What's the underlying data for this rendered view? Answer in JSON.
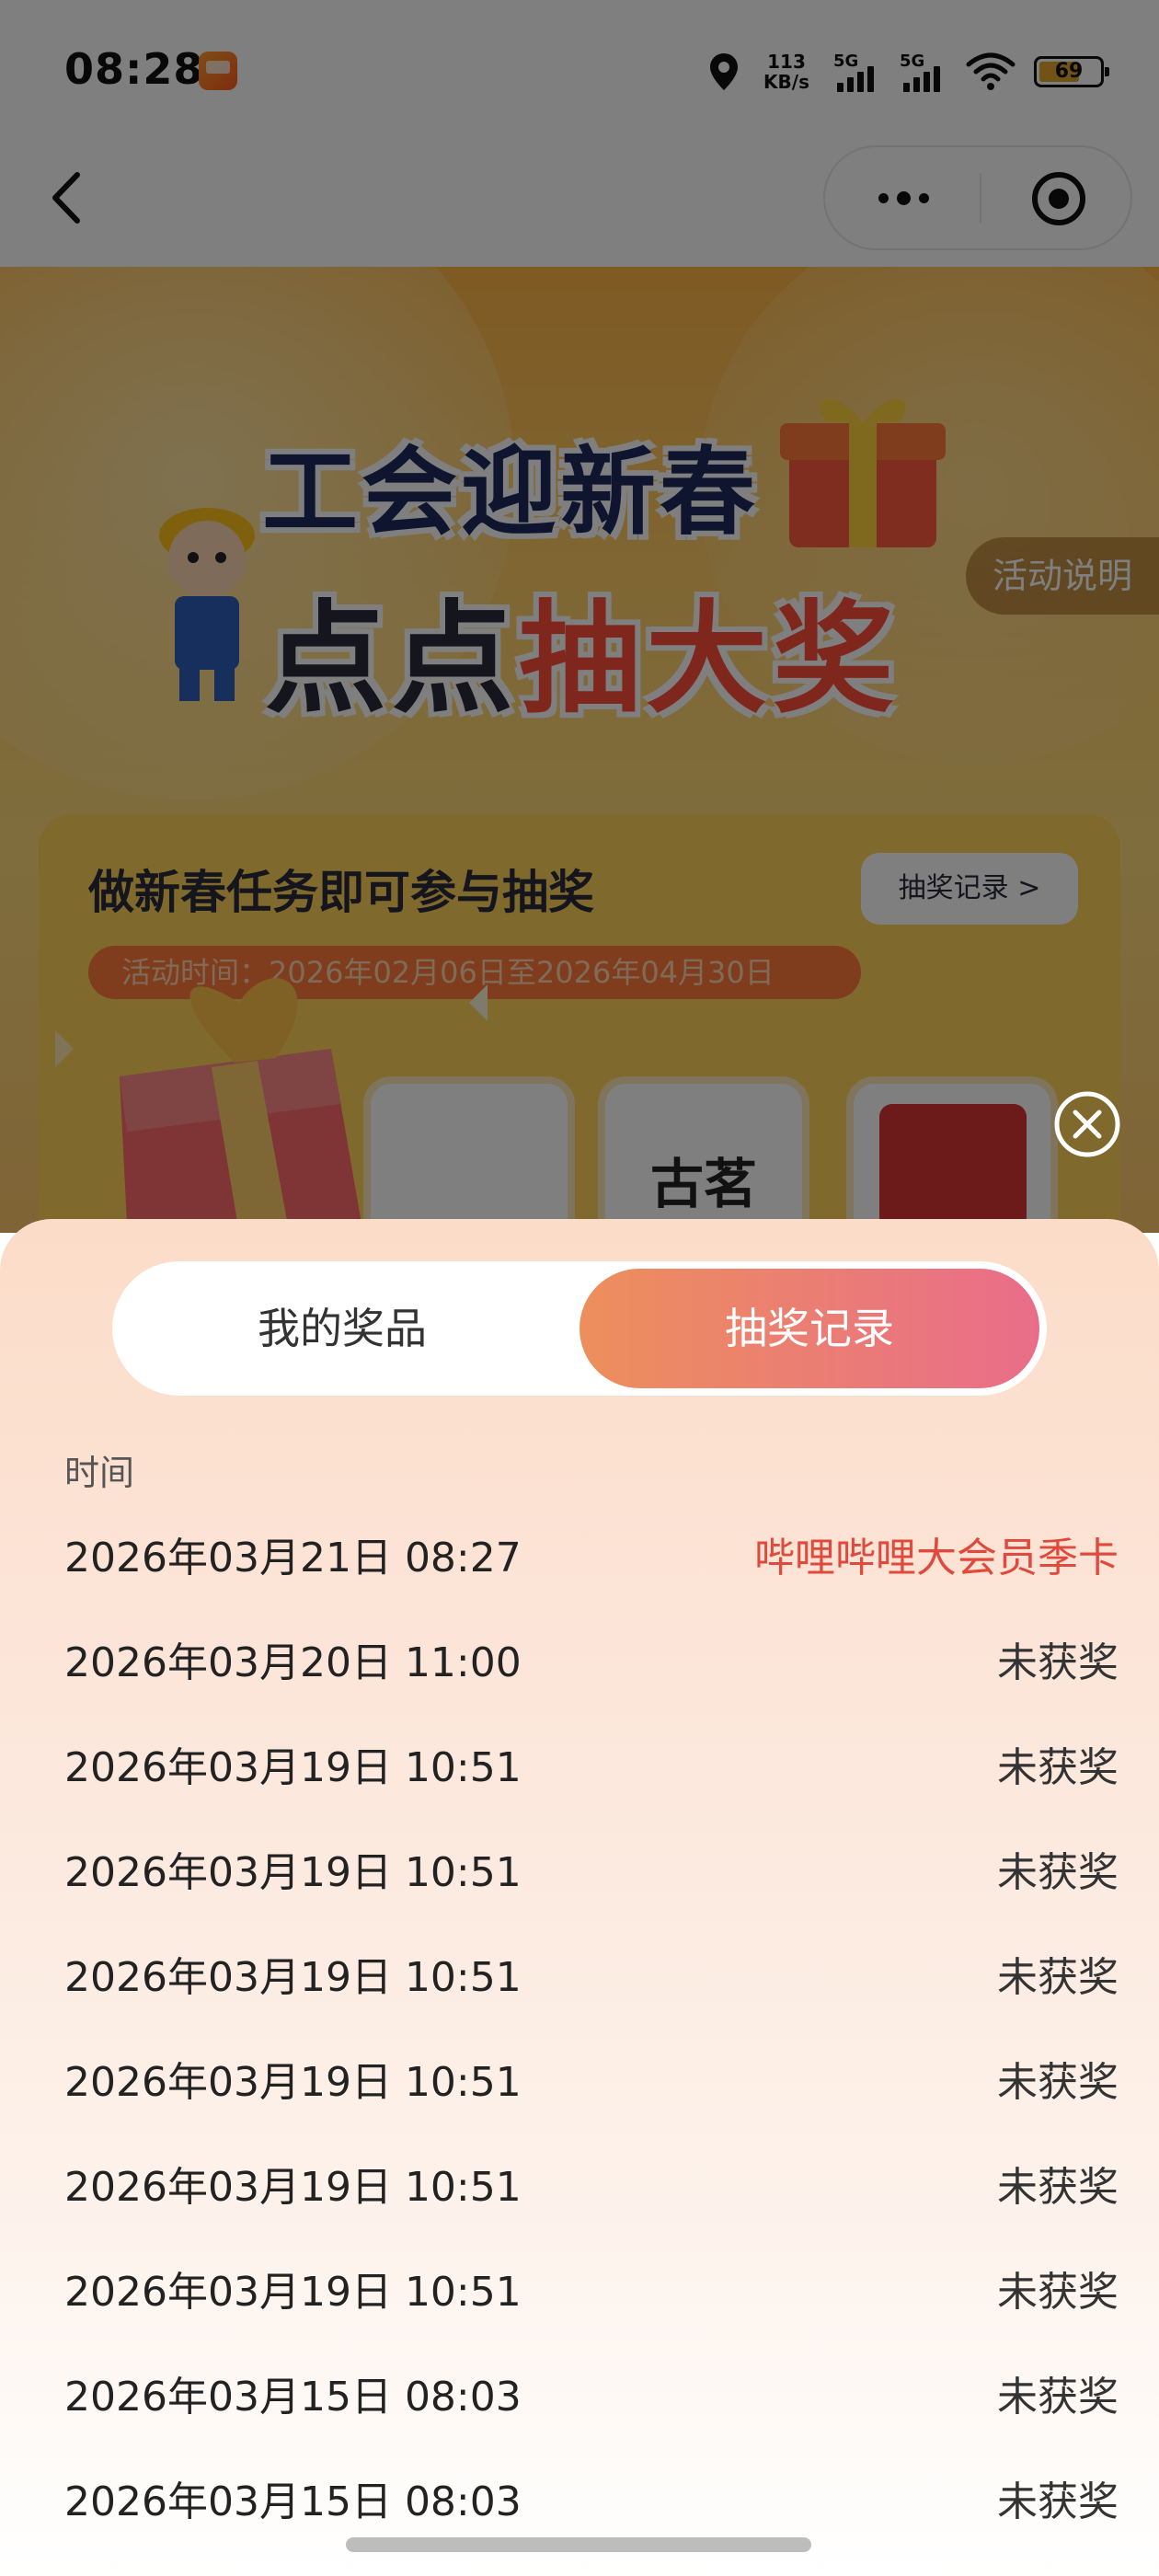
{
  "status_bar": {
    "time": "08:28",
    "app_icon": "taobao-flash-icon",
    "net_speed_value": "113",
    "net_speed_unit": "KB/s",
    "signal1_label": "5G",
    "signal2_label": "5G",
    "battery": "69"
  },
  "nav": {
    "back_icon": "chevron-left-icon",
    "more_icon": "more-dots-icon",
    "close_icon": "target-icon"
  },
  "banner": {
    "title_line1": "工会迎新春",
    "title_line2_part1": "点点",
    "title_line2_part2": "抽大奖",
    "rules_button": "活动说明",
    "card_title": "做新春任务即可参与抽奖",
    "record_button": "抽奖记录 >",
    "activity_time": "活动时间：2026年02月06日至2026年04月30日",
    "tile_brand": "古茗"
  },
  "sheet": {
    "tabs": [
      {
        "label": "我的奖品",
        "active": false
      },
      {
        "label": "抽奖记录",
        "active": true
      }
    ],
    "column_header": "时间",
    "records": [
      {
        "time": "2026年03月21日 08:27",
        "result": "哔哩哔哩大会员季卡"
      },
      {
        "time": "2026年03月20日 11:00",
        "result": "未获奖"
      },
      {
        "time": "2026年03月19日 10:51",
        "result": "未获奖"
      },
      {
        "time": "2026年03月19日 10:51",
        "result": "未获奖"
      },
      {
        "time": "2026年03月19日 10:51",
        "result": "未获奖"
      },
      {
        "time": "2026年03月19日 10:51",
        "result": "未获奖"
      },
      {
        "time": "2026年03月19日 10:51",
        "result": "未获奖"
      },
      {
        "time": "2026年03月19日 10:51",
        "result": "未获奖"
      },
      {
        "time": "2026年03月15日 08:03",
        "result": "未获奖"
      },
      {
        "time": "2026年03月15日 08:03",
        "result": "未获奖"
      }
    ]
  },
  "colors": {
    "accent_gradient_start": "#ed8f5c",
    "accent_gradient_end": "#e96d8a",
    "win_text": "#e04a3c"
  }
}
